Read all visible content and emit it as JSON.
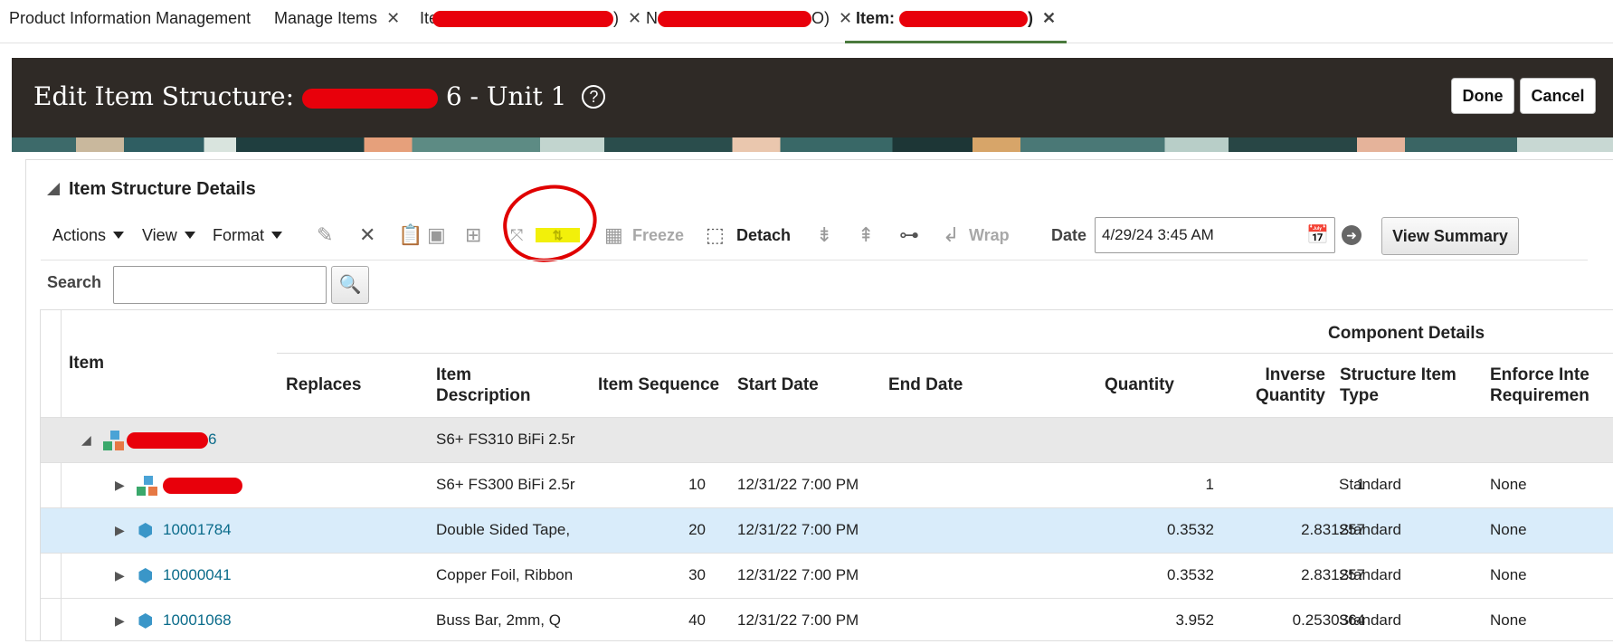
{
  "tabs": [
    {
      "label": "Product Information Management",
      "closable": false
    },
    {
      "label": "Manage Items",
      "closable": true
    },
    {
      "label": "Ite",
      "redacted": true,
      "closable": true
    },
    {
      "label": "N",
      "redacted": true,
      "closable": true
    },
    {
      "label": "Item:",
      "redacted": true,
      "active": true,
      "closable": true
    }
  ],
  "tab_partials": {
    "t3_tail": ")",
    "t4_tail": "O)",
    "t5_tail": ")"
  },
  "header": {
    "title_prefix": "Edit Item Structure:",
    "title_suffix": "6 - Unit 1",
    "help_label": "?",
    "done_label": "Done",
    "cancel_label": "Cancel"
  },
  "section": {
    "title": "Item Structure Details"
  },
  "toolbar": {
    "actions_label": "Actions",
    "view_label": "View",
    "format_label": "Format",
    "freeze_label": "Freeze",
    "detach_label": "Detach",
    "wrap_label": "Wrap",
    "date_label": "Date",
    "date_value": "4/29/24 3:45 AM",
    "view_summary_label": "View Summary",
    "icons": [
      "edit-icon",
      "delete-icon",
      "copy-icon",
      "paste-icon",
      "add-row-icon",
      "collapse-icon",
      "reorder-icon",
      "freeze-icon",
      "detach-icon",
      "indent-icon",
      "outdent-icon",
      "hierarchy-icon",
      "wrap-icon",
      "calendar-icon",
      "go-icon"
    ]
  },
  "search": {
    "label": "Search",
    "placeholder": ""
  },
  "table": {
    "group_header": "Component Details",
    "columns": {
      "item": "Item",
      "replaces": "Replaces",
      "desc_1": "Item",
      "desc_2": "Description",
      "seq": "Item Sequence",
      "start": "Start Date",
      "end": "End Date",
      "qty": "Quantity",
      "inv_1": "Inverse",
      "inv_2": "Quantity",
      "type_1": "Structure Item",
      "type_2": "Type",
      "enf_1": "Enforce Inte",
      "enf_2": "Requiremen"
    },
    "rows": [
      {
        "item": "6",
        "redacted": true,
        "description": "S6+ FS310 BiFi 2.5r",
        "sequence": "",
        "start": "",
        "end": "",
        "quantity": "",
        "inverse": "",
        "type": "",
        "enforce": ""
      },
      {
        "item": "",
        "redacted": true,
        "description": "S6+ FS300 BiFi 2.5r",
        "sequence": "10",
        "start": "12/31/22 7:00 PM",
        "end": "",
        "quantity": "1",
        "inverse": "1",
        "type": "Standard",
        "enforce": "None"
      },
      {
        "item": "10001784",
        "description": "Double Sided Tape,",
        "sequence": "20",
        "start": "12/31/22 7:00 PM",
        "end": "",
        "quantity": "0.3532",
        "inverse": "2.831257",
        "type": "Standard",
        "enforce": "None"
      },
      {
        "item": "10000041",
        "description": "Copper Foil, Ribbon",
        "sequence": "30",
        "start": "12/31/22 7:00 PM",
        "end": "",
        "quantity": "0.3532",
        "inverse": "2.831257",
        "type": "Standard",
        "enforce": "None"
      },
      {
        "item": "10001068",
        "description": "Buss Bar, 2mm, Q",
        "sequence": "40",
        "start": "12/31/22 7:00 PM",
        "end": "",
        "quantity": "3.952",
        "inverse": "0.2530364",
        "type": "Standard",
        "enforce": "None"
      }
    ]
  },
  "colors": {
    "header_bg": "#2f2a26",
    "active_tab_border": "#4a7a3d",
    "selected_row": "#d9ecfa",
    "link": "#0a6b8a",
    "redaction": "#e8000b",
    "highlight": "#f2f00a",
    "annotation": "#e00000"
  }
}
